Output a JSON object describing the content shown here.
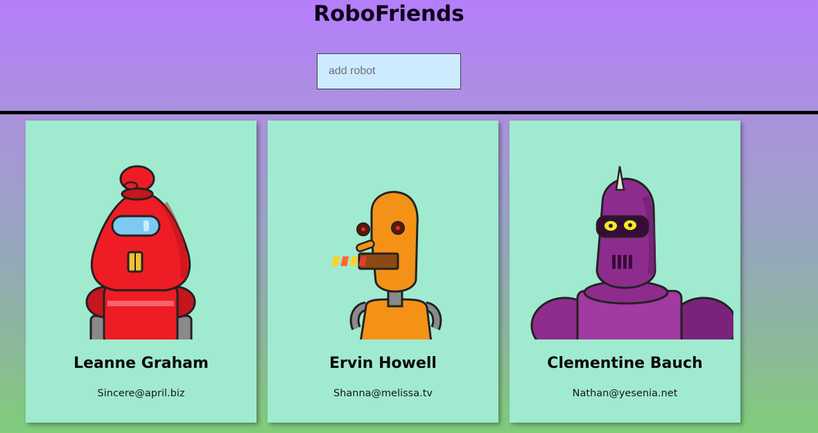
{
  "app": {
    "title": "RoboFriends"
  },
  "search": {
    "placeholder": "add robot",
    "value": ""
  },
  "robots": [
    {
      "name": "Leanne Graham",
      "email": "Sincere@april.biz",
      "avatar_icon": "red-robot-avatar",
      "color": "#ee1c25"
    },
    {
      "name": "Ervin Howell",
      "email": "Shanna@melissa.tv",
      "avatar_icon": "orange-robot-avatar",
      "color": "#f39217"
    },
    {
      "name": "Clementine Bauch",
      "email": "Nathan@yesenia.net",
      "avatar_icon": "purple-robot-avatar",
      "color": "#8e2c8e"
    }
  ],
  "colors": {
    "gradient_top": "#b57efb",
    "gradient_bottom": "#80cd7a",
    "card_bg": "#a0ead0",
    "search_bg": "#cdebff"
  }
}
